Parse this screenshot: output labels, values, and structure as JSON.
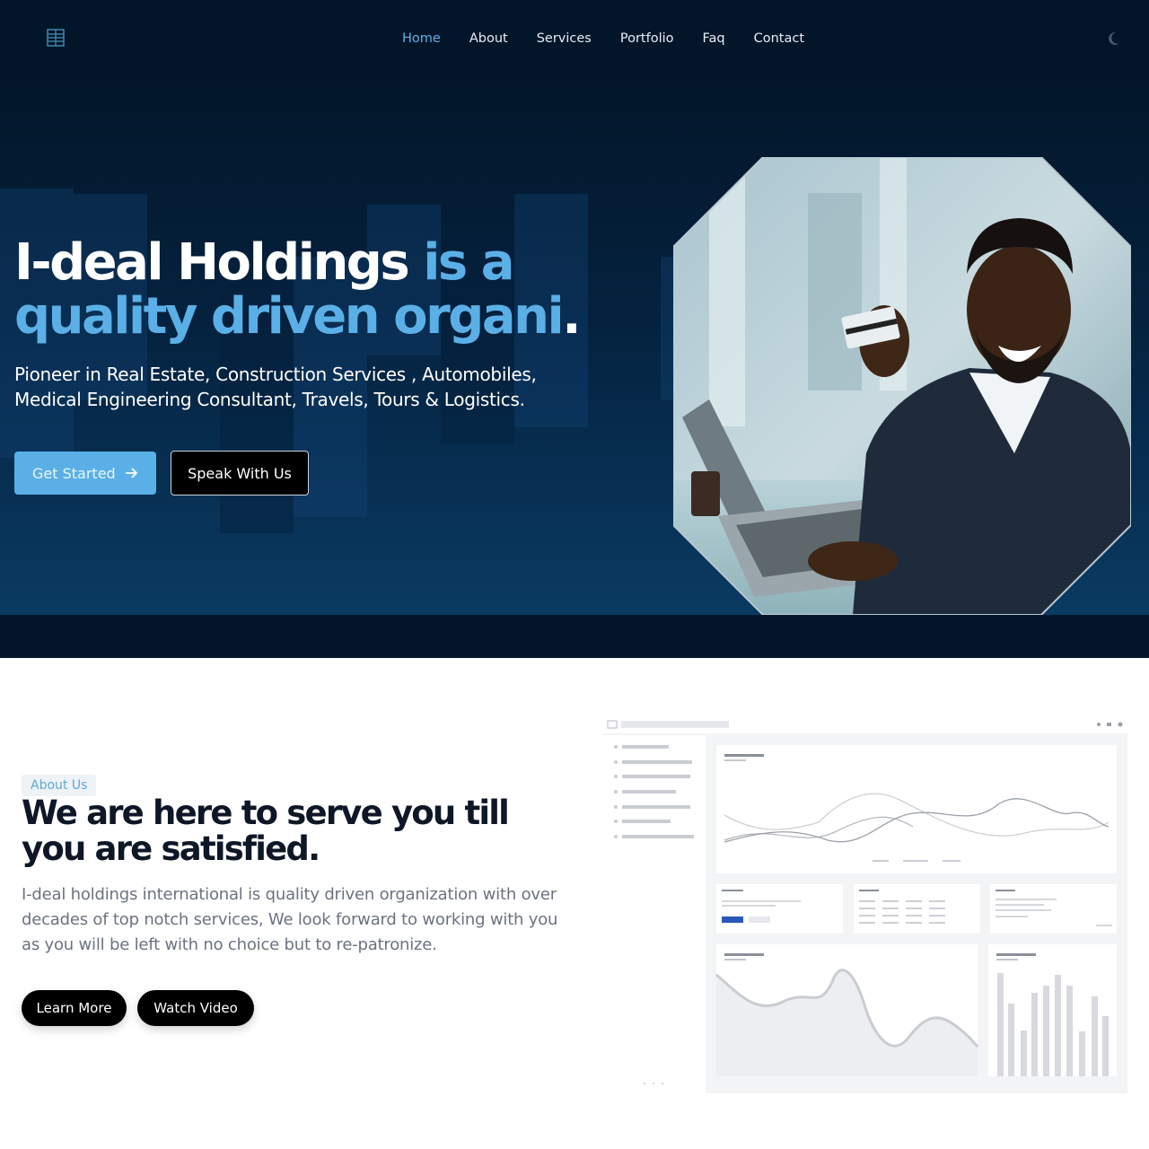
{
  "nav": {
    "items": [
      {
        "label": "Home",
        "active": true
      },
      {
        "label": "About"
      },
      {
        "label": "Services"
      },
      {
        "label": "Portfolio"
      },
      {
        "label": "Faq"
      },
      {
        "label": "Contact"
      }
    ],
    "logo_icon": "building-logo-icon",
    "theme_icon": "moon-icon"
  },
  "hero": {
    "title_white": "I-deal Holdings ",
    "title_blue_1": "is a",
    "title_blue_2": "quality driven organi",
    "title_end": ".",
    "subtitle": "Pioneer in Real Estate, Construction Services , Automobiles, Medical Engineering Consultant, Travels, Tours & Logistics.",
    "cta_primary": "Get Started",
    "cta_secondary": "Speak With Us"
  },
  "about": {
    "tag": "About Us",
    "title": "We are here to serve you till you are satisfied.",
    "text": "I-deal holdings international is quality driven organization with over decades of top notch services, We look forward to working with you as you will be left with no choice but to re-patronize.",
    "btn_learn": "Learn More",
    "btn_video": "Watch Video"
  },
  "colors": {
    "nav_bg": "#031629",
    "accent": "#5ab0e6",
    "hero_bottom": "#0a3a62",
    "heading_dark": "#0e1726",
    "body_gray": "#6b7280"
  }
}
